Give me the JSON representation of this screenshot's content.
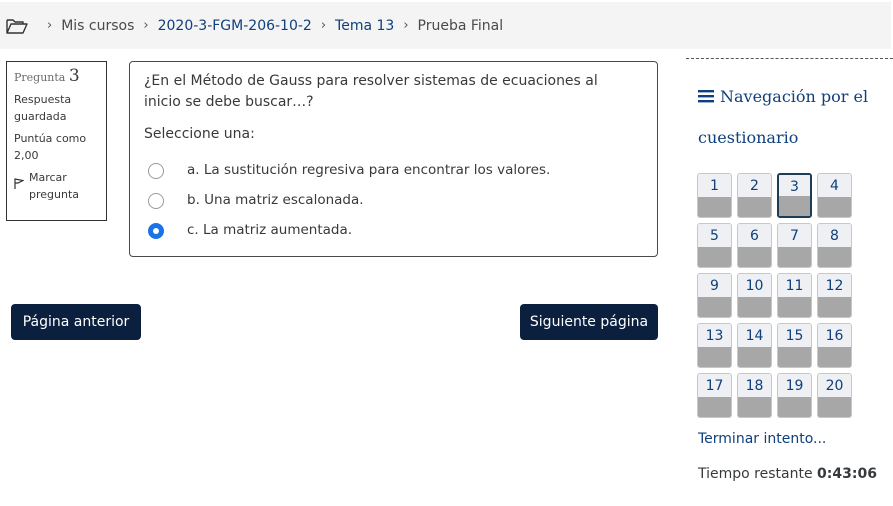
{
  "breadcrumb": {
    "items": [
      "Mis cursos",
      "2020-3-FGM-206-10-2",
      "Tema 13",
      "Prueba Final"
    ],
    "separator": "›"
  },
  "question_info": {
    "label": "Pregunta",
    "number": "3",
    "state": "Respuesta guardada",
    "grade": "Puntúa como 2,00",
    "flag_label": "Marcar pregunta"
  },
  "question": {
    "text": "¿En el Método de Gauss para resolver sistemas de ecuaciones al inicio se debe buscar…?",
    "prompt": "Seleccione una:",
    "answers": [
      {
        "label": "a. La sustitución regresiva para encontrar los valores.",
        "checked": false
      },
      {
        "label": "b. Una matriz escalonada.",
        "checked": false
      },
      {
        "label": "c. La matriz aumentada.",
        "checked": true
      }
    ]
  },
  "buttons": {
    "prev": "Página anterior",
    "next": "Siguiente página"
  },
  "quiz_nav": {
    "title": "Navegación por el cuestionario",
    "current": 3,
    "questions": [
      "1",
      "2",
      "3",
      "4",
      "5",
      "6",
      "7",
      "8",
      "9",
      "10",
      "11",
      "12",
      "13",
      "14",
      "15",
      "16",
      "17",
      "18",
      "19",
      "20"
    ],
    "finish_link": "Terminar intento...",
    "time_label": "Tiempo restante",
    "time_value": "0:43:06"
  },
  "colors": {
    "link": "#0f3f7c",
    "button_bg": "#0b1f3f",
    "radio_checked": "#1a73e8",
    "answered_bar": "#a7a7a7"
  },
  "icons": [
    "folder-icon",
    "flag-icon",
    "hamburger-icon"
  ]
}
